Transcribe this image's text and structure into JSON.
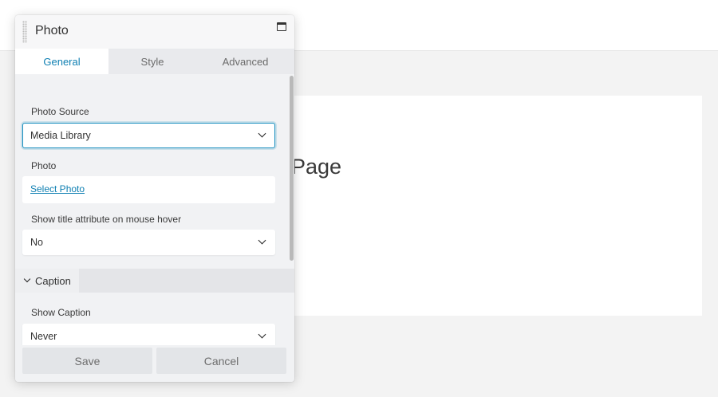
{
  "background_page": {
    "heading_fragment": "t Page"
  },
  "panel": {
    "title": "Photo",
    "tabs": [
      {
        "label": "General",
        "active": true
      },
      {
        "label": "Style",
        "active": false
      },
      {
        "label": "Advanced",
        "active": false
      }
    ],
    "fields": {
      "photo_source": {
        "label": "Photo Source",
        "value": "Media Library"
      },
      "photo": {
        "label": "Photo",
        "link": "Select Photo"
      },
      "title_hover": {
        "label": "Show title attribute on mouse hover",
        "value": "No"
      },
      "show_caption": {
        "label": "Show Caption",
        "value": "Never"
      }
    },
    "section": {
      "label": "Caption",
      "expanded": true
    },
    "buttons": {
      "save": "Save",
      "cancel": "Cancel"
    }
  },
  "colors": {
    "accent": "#0e7fb2",
    "panel_bg": "#f1f2f4",
    "page_bg": "#f3f3f3"
  },
  "icons": {
    "drag_handle": "drag-handle-icon",
    "window": "window-icon",
    "chevron": "chevron-down-icon"
  }
}
